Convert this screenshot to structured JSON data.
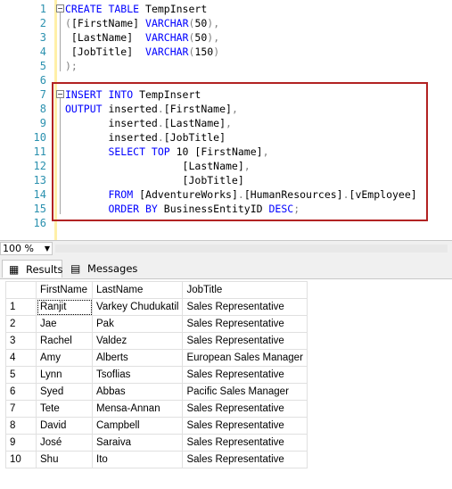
{
  "editor": {
    "lines": [
      {
        "n": "1",
        "tokens": [
          [
            "kw",
            "CREATE TABLE "
          ],
          [
            "pl",
            "TempInsert"
          ]
        ]
      },
      {
        "n": "2",
        "tokens": [
          [
            "gr",
            "("
          ],
          [
            "pl",
            "[FirstName] "
          ],
          [
            "kw",
            "VARCHAR"
          ],
          [
            "gr",
            "("
          ],
          [
            "nm",
            "50"
          ],
          [
            "gr",
            "),"
          ]
        ]
      },
      {
        "n": "3",
        "tokens": [
          [
            "pl",
            " [LastName]  "
          ],
          [
            "kw",
            "VARCHAR"
          ],
          [
            "gr",
            "("
          ],
          [
            "nm",
            "50"
          ],
          [
            "gr",
            "),"
          ]
        ]
      },
      {
        "n": "4",
        "tokens": [
          [
            "pl",
            " [JobTitle]  "
          ],
          [
            "kw",
            "VARCHAR"
          ],
          [
            "gr",
            "("
          ],
          [
            "nm",
            "150"
          ],
          [
            "gr",
            ")"
          ]
        ]
      },
      {
        "n": "5",
        "tokens": [
          [
            "gr",
            ");"
          ]
        ]
      },
      {
        "n": "6",
        "tokens": []
      },
      {
        "n": "7",
        "tokens": [
          [
            "kw",
            "INSERT INTO "
          ],
          [
            "pl",
            "TempInsert"
          ]
        ]
      },
      {
        "n": "8",
        "tokens": [
          [
            "kw",
            "OUTPUT "
          ],
          [
            "pl",
            "inserted"
          ],
          [
            "gr",
            "."
          ],
          [
            "pl",
            "[FirstName]"
          ],
          [
            "gr",
            ","
          ]
        ]
      },
      {
        "n": "9",
        "tokens": [
          [
            "pl",
            "       inserted"
          ],
          [
            "gr",
            "."
          ],
          [
            "pl",
            "[LastName]"
          ],
          [
            "gr",
            ","
          ]
        ]
      },
      {
        "n": "10",
        "tokens": [
          [
            "pl",
            "       inserted"
          ],
          [
            "gr",
            "."
          ],
          [
            "pl",
            "[JobTitle]"
          ]
        ]
      },
      {
        "n": "11",
        "tokens": [
          [
            "kw",
            "       SELECT TOP "
          ],
          [
            "nm",
            "10 "
          ],
          [
            "pl",
            "[FirstName]"
          ],
          [
            "gr",
            ","
          ]
        ]
      },
      {
        "n": "12",
        "tokens": [
          [
            "pl",
            "                   [LastName]"
          ],
          [
            "gr",
            ","
          ]
        ]
      },
      {
        "n": "13",
        "tokens": [
          [
            "pl",
            "                   [JobTitle]"
          ]
        ]
      },
      {
        "n": "14",
        "tokens": [
          [
            "kw",
            "       FROM "
          ],
          [
            "pl",
            "[AdventureWorks]"
          ],
          [
            "gr",
            "."
          ],
          [
            "pl",
            "[HumanResources]"
          ],
          [
            "gr",
            "."
          ],
          [
            "pl",
            "[vEmployee]"
          ]
        ]
      },
      {
        "n": "15",
        "tokens": [
          [
            "kw",
            "       ORDER BY "
          ],
          [
            "pl",
            "BusinessEntityID "
          ],
          [
            "kw",
            "DESC"
          ],
          [
            "gr",
            ";"
          ]
        ]
      },
      {
        "n": "16",
        "tokens": []
      }
    ]
  },
  "status": {
    "zoom": "100 %"
  },
  "tabs": {
    "results": "Results",
    "messages": "Messages"
  },
  "grid": {
    "headers": [
      "",
      "FirstName",
      "LastName",
      "JobTitle"
    ],
    "rows": [
      [
        "1",
        "Ranjit",
        "Varkey Chudukatil",
        "Sales Representative"
      ],
      [
        "2",
        "Jae",
        "Pak",
        "Sales Representative"
      ],
      [
        "3",
        "Rachel",
        "Valdez",
        "Sales Representative"
      ],
      [
        "4",
        "Amy",
        "Alberts",
        "European Sales Manager"
      ],
      [
        "5",
        "Lynn",
        "Tsoflias",
        "Sales Representative"
      ],
      [
        "6",
        "Syed",
        "Abbas",
        "Pacific Sales Manager"
      ],
      [
        "7",
        "Tete",
        "Mensa-Annan",
        "Sales Representative"
      ],
      [
        "8",
        "David",
        "Campbell",
        "Sales Representative"
      ],
      [
        "9",
        "José",
        "Saraiva",
        "Sales Representative"
      ],
      [
        "10",
        "Shu",
        "Ito",
        "Sales Representative"
      ]
    ]
  },
  "colors": {
    "keyword": "#0000ff",
    "linenumber": "#2b91af",
    "highlight_box": "#b22222"
  }
}
